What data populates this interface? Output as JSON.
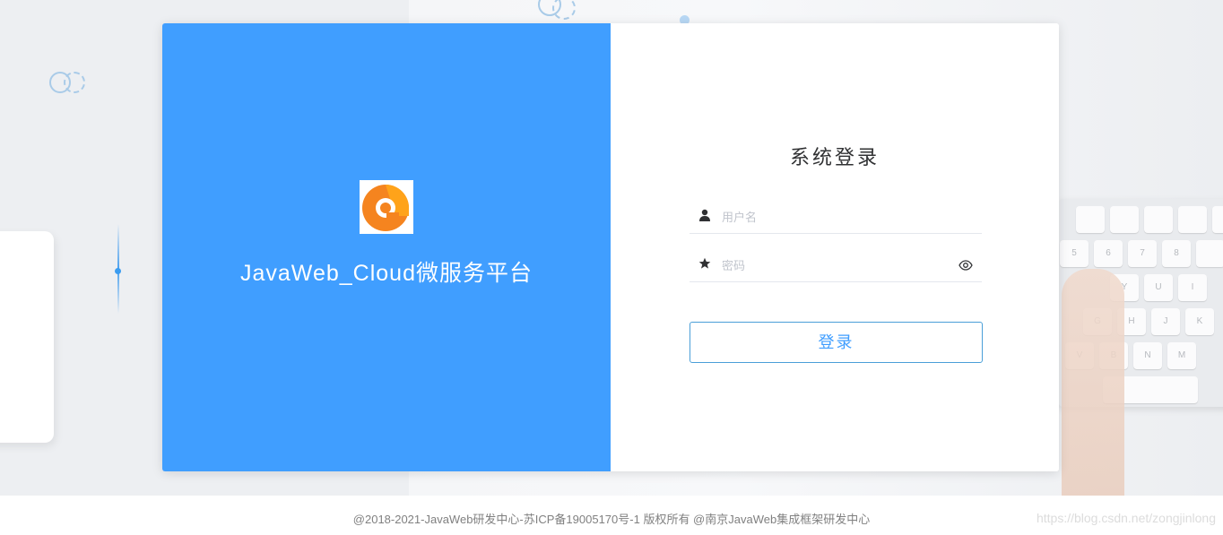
{
  "brand": {
    "platform_title": "JavaWeb_Cloud微服务平台",
    "accent_color": "#409eff",
    "logo_icon": "orange-chat-bubble-logo"
  },
  "login": {
    "title": "系统登录",
    "username": {
      "placeholder": "用户名",
      "icon": "user-icon",
      "value": ""
    },
    "password": {
      "placeholder": "密码",
      "icon": "star-icon",
      "toggle_icon": "eye-icon",
      "value": ""
    },
    "submit_label": "登录"
  },
  "footer": {
    "copyright": "@2018-2021-JavaWeb研发中心-苏ICP备19005170号-1 版权所有 @南京JavaWeb集成框架研发中心",
    "watermark": "https://blog.csdn.net/zongjinlong"
  },
  "background": {
    "keyboard_keys": [
      "5",
      "6",
      "7",
      "8",
      "Y",
      "U",
      "I",
      "G",
      "H",
      "J",
      "K",
      "V",
      "B",
      "N",
      "M"
    ]
  }
}
